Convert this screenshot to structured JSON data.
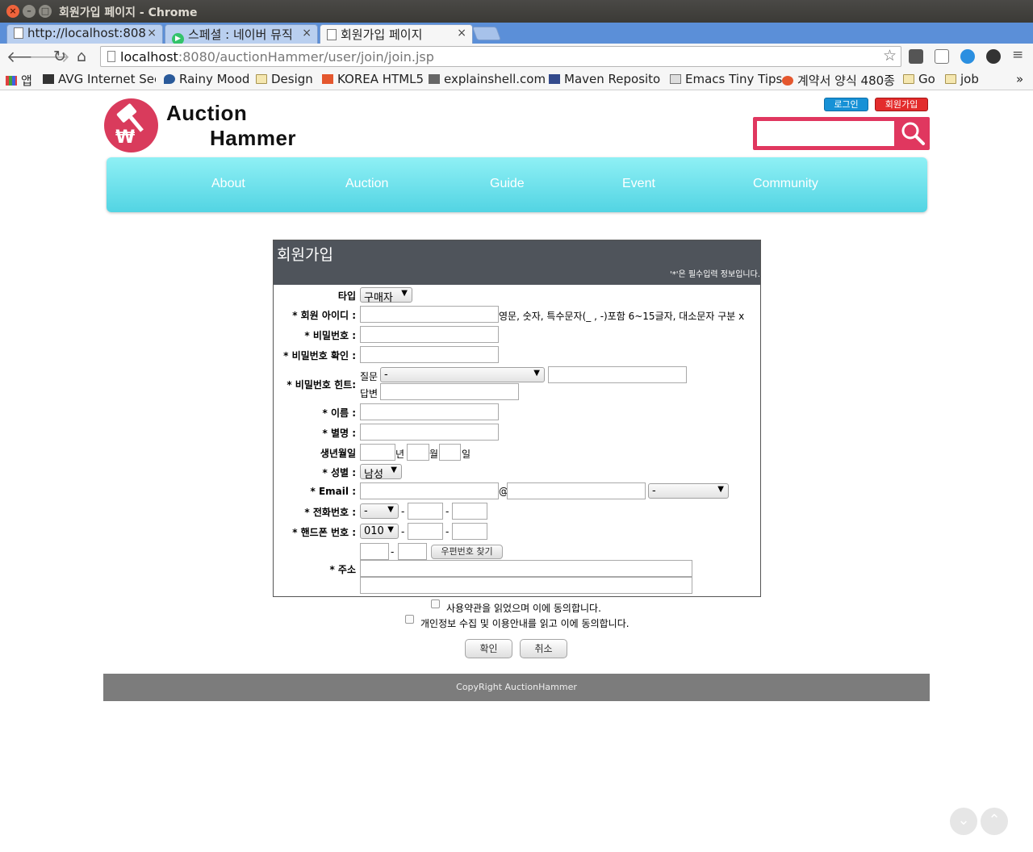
{
  "window": {
    "title": "회원가입 페이지 - Chrome"
  },
  "tabs": [
    {
      "label": "http://localhost:808",
      "close": "×"
    },
    {
      "label": "스페셜 : 네이버 뮤직",
      "close": "×"
    },
    {
      "label": "회원가입 페이지",
      "close": "×"
    }
  ],
  "address": {
    "host": "localhost",
    "path": ":8080/auctionHammer/user/join/join.jsp"
  },
  "bookmarks": {
    "apps": "앱",
    "items": [
      "AVG Internet Secu",
      "Rainy Mood",
      "Design",
      "KOREA HTML5",
      "explainshell.com",
      "Maven Repositor",
      "Emacs Tiny Tips",
      "계약서 양식 480종",
      "Go",
      "job"
    ],
    "more": "»"
  },
  "header": {
    "logo_line1": "Auction",
    "logo_line2": "Hammer",
    "login": "로그인",
    "join": "회원가입"
  },
  "nav": [
    "About",
    "Auction",
    "Guide",
    "Event",
    "Community"
  ],
  "form": {
    "title": "회원가입",
    "note": "'*'은 필수입력 정보입니다.",
    "type_label": "타입",
    "type_value": "구매자",
    "id_label": "* 회원 아이디 :",
    "id_hint": "영문, 숫자, 특수문자(_ , -)포함 6~15글자, 대소문자 구분 x",
    "pw_label": "* 비밀번호 :",
    "pw_confirm_label": "* 비밀번호 확인 :",
    "hint_label": "* 비밀번호 힌트:",
    "question_label": "질문",
    "question_value": "-",
    "answer_label": "답변",
    "name_label": "* 이름 :",
    "nickname_label": "* 별명 :",
    "birth_label": "생년월일",
    "year": "년",
    "month": "월",
    "day": "일",
    "gender_label": "* 성별 :",
    "gender_value": "남성",
    "email_label": "* Email :",
    "at": "@",
    "email_domain_value": "-",
    "phone_label": "* 전화번호 :",
    "phone_prefix": "-",
    "mobile_label": "* 핸드폰 번호 :",
    "mobile_prefix": "010",
    "dash": "-",
    "zip_button": "우편번호 찾기",
    "address_label": "* 주소"
  },
  "agreements": {
    "terms": "사용약관을 읽었으며 이에 동의합니다.",
    "privacy": "개인정보 수집 및 이용안내를 읽고 이에 동의합니다."
  },
  "buttons": {
    "confirm": "확인",
    "cancel": "취소"
  },
  "footer": "CopyRight AuctionHammer"
}
